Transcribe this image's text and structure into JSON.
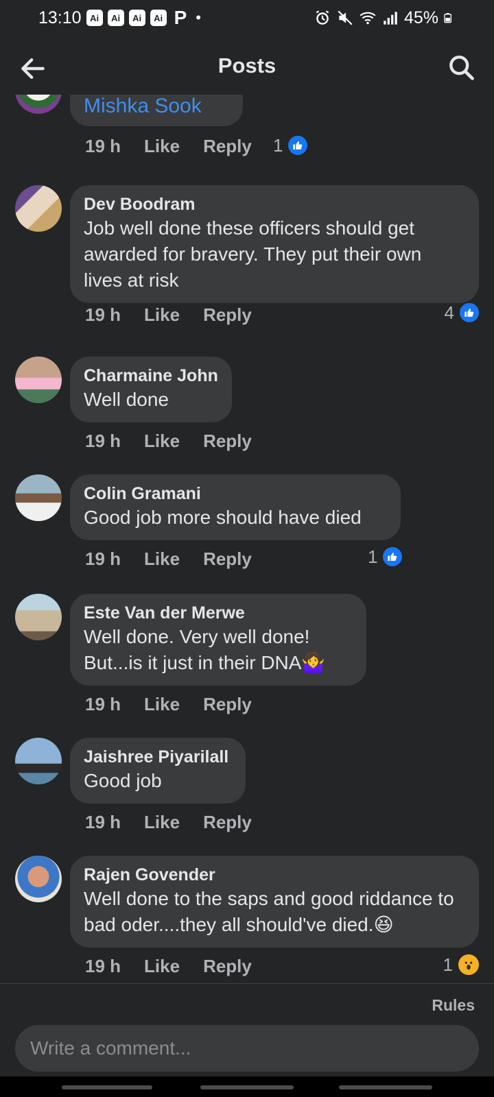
{
  "status_bar": {
    "time": "13:10",
    "ai_badges": [
      "Ai",
      "Ai",
      "Ai",
      "Ai"
    ],
    "app_icon": "P",
    "dot": "•",
    "battery": "45%",
    "icons": [
      "alarm-icon",
      "mute-icon",
      "wifi-icon",
      "signal-icon",
      "battery-icon"
    ]
  },
  "header": {
    "title": "Posts",
    "back_icon": "back-arrow-icon",
    "search_icon": "search-icon"
  },
  "comments": [
    {
      "author": "",
      "tagged": "Mishka Sook",
      "time": "19 h",
      "like": "Like",
      "reply": "Reply",
      "reaction_count": "1",
      "reaction": "like"
    },
    {
      "author": "Dev Boodram",
      "text": "Job well done these officers should get awarded for bravery. They put their own lives at risk",
      "time": "19 h",
      "like": "Like",
      "reply": "Reply",
      "reaction_count": "4",
      "reaction": "like"
    },
    {
      "author": "Charmaine John",
      "text": "Well done",
      "time": "19 h",
      "like": "Like",
      "reply": "Reply"
    },
    {
      "author": "Colin Gramani",
      "text": "Good job more should have died",
      "time": "19 h",
      "like": "Like",
      "reply": "Reply",
      "reaction_count": "1",
      "reaction": "like"
    },
    {
      "author": "Este Van der Merwe",
      "text_line1": "Well done. Very well done!",
      "text_line2": "But...is it just in their DNA🤷‍♀️",
      "time": "19 h",
      "like": "Like",
      "reply": "Reply"
    },
    {
      "author": "Jaishree Piyarilall",
      "text": "Good job",
      "time": "19 h",
      "like": "Like",
      "reply": "Reply"
    },
    {
      "author": "Rajen Govender",
      "text": "Well done to the saps and good riddance to bad oder....they all should've died.😆",
      "time": "19 h",
      "like": "Like",
      "reply": "Reply",
      "reaction_count": "1",
      "reaction": "wow"
    }
  ],
  "composer": {
    "rules": "Rules",
    "placeholder": "Write a comment..."
  },
  "colors": {
    "background": "#242526",
    "bubble": "#3a3b3c",
    "link": "#3f8ef0",
    "like_blue": "#1877f2",
    "muted": "#b0b3b8"
  }
}
